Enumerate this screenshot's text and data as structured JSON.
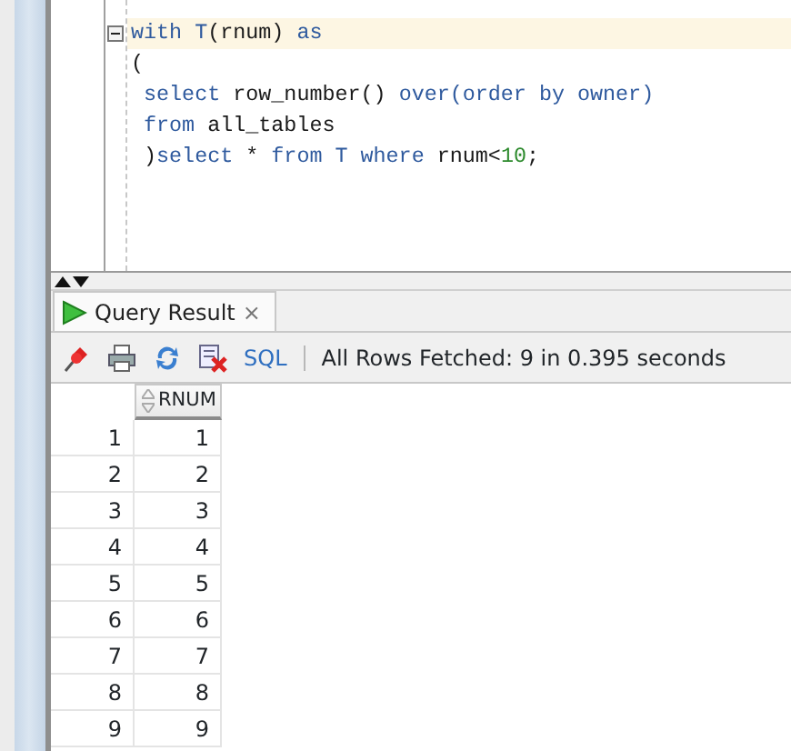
{
  "editor": {
    "lines": [
      {
        "current": true,
        "foldable": true,
        "tokens": [
          {
            "kind": "keyword",
            "text": "with T"
          },
          {
            "kind": "plain",
            "text": "(rnum) "
          },
          {
            "kind": "keyword",
            "text": "as"
          }
        ]
      },
      {
        "current": false,
        "foldable": false,
        "tokens": [
          {
            "kind": "plain",
            "text": "("
          }
        ]
      },
      {
        "current": false,
        "foldable": false,
        "tokens": [
          {
            "kind": "keyword",
            "text": " select"
          },
          {
            "kind": "plain",
            "text": " row_number() "
          },
          {
            "kind": "keyword",
            "text": "over(order by owner)"
          }
        ]
      },
      {
        "current": false,
        "foldable": false,
        "tokens": [
          {
            "kind": "keyword",
            "text": " from"
          },
          {
            "kind": "plain",
            "text": " all_tables"
          }
        ]
      },
      {
        "current": false,
        "foldable": false,
        "tokens": [
          {
            "kind": "plain",
            "text": " )"
          },
          {
            "kind": "keyword",
            "text": "select"
          },
          {
            "kind": "plain",
            "text": " * "
          },
          {
            "kind": "keyword",
            "text": "from T where"
          },
          {
            "kind": "plain",
            "text": " rnum<"
          },
          {
            "kind": "number",
            "text": "10"
          },
          {
            "kind": "plain",
            "text": ";"
          }
        ]
      }
    ]
  },
  "result_tab": {
    "label": "Query Result",
    "close": "×",
    "selected": true
  },
  "toolbar": {
    "sql_link": "SQL",
    "status": "All Rows Fetched: 9 in 0.395 seconds"
  },
  "grid": {
    "columns": [
      "RNUM"
    ],
    "rows": [
      {
        "row_number": "1",
        "rnum": "1"
      },
      {
        "row_number": "2",
        "rnum": "2"
      },
      {
        "row_number": "3",
        "rnum": "3"
      },
      {
        "row_number": "4",
        "rnum": "4"
      },
      {
        "row_number": "5",
        "rnum": "5"
      },
      {
        "row_number": "6",
        "rnum": "6"
      },
      {
        "row_number": "7",
        "rnum": "7"
      },
      {
        "row_number": "8",
        "rnum": "8"
      },
      {
        "row_number": "9",
        "rnum": "9"
      }
    ]
  }
}
